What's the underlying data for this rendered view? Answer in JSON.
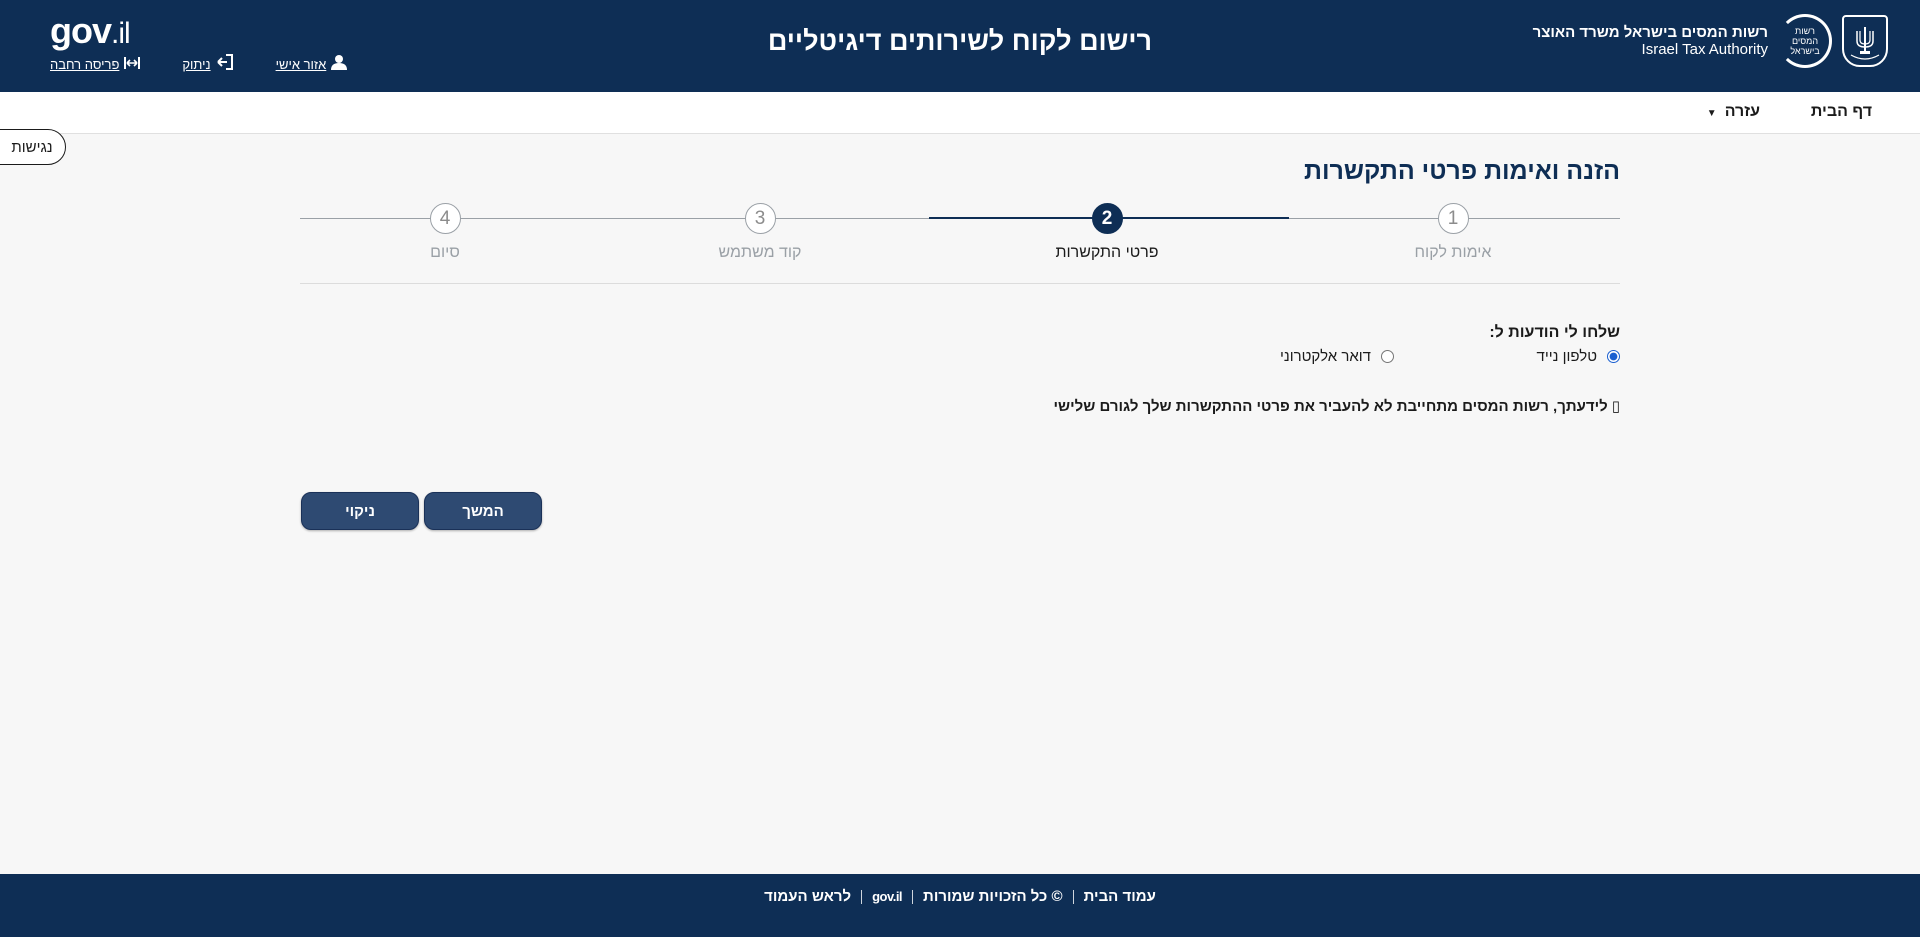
{
  "header": {
    "agency_he": "רשות המסים בישראל משרד האוצר",
    "agency_en": "Israel Tax Authority",
    "ita_logo_text": "רשות המסים בישראל",
    "title": "רישום לקוח לשירותים דיגיטליים",
    "govil_main": "gov",
    "govil_v": "v",
    "govil_il": ".il",
    "links": {
      "personal_area": "אזור אישי",
      "logout": "ניתוק",
      "wide_layout": "פריסה רחבה"
    },
    "icons": {
      "personal_area": "user-icon",
      "logout": "logout-icon",
      "wide_layout": "expand-width-icon"
    },
    "colors": {
      "primary": "#0e2e55"
    }
  },
  "nav": {
    "home": "דף הבית",
    "help": "עזרה"
  },
  "accessibility": "נגישות",
  "main": {
    "title": "הזנה ואימות פרטי התקשרות",
    "steps": [
      {
        "number": "1",
        "label": "אימות לקוח"
      },
      {
        "number": "2",
        "label": "פרטי התקשרות"
      },
      {
        "number": "3",
        "label": "קוד משתמש"
      },
      {
        "number": "4",
        "label": "סיום"
      }
    ],
    "current_step": 2,
    "notify_label": "שלחו לי הודעות ל:",
    "options": {
      "mobile": "טלפון נייד",
      "email": "דואר אלקטרוני",
      "selected": "mobile"
    },
    "notice": "לידעתך, רשות המסים מתחייבת לא להעביר את פרטי ההתקשרות שלך לגורם שלישי",
    "buttons": {
      "continue": "המשך",
      "clear": "ניקוי"
    }
  },
  "footer": {
    "home_page": "עמוד הבית",
    "copyright": "© כל הזכויות שמורות",
    "gov": "gov.il",
    "to_top": "לראש העמוד"
  }
}
